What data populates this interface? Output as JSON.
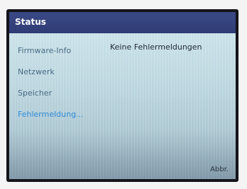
{
  "header": {
    "title": "Status"
  },
  "menu": {
    "items": [
      {
        "label": "Firmware-Info"
      },
      {
        "label": "Netzwerk"
      },
      {
        "label": "Speicher"
      },
      {
        "label": "Fehlermeldung..."
      }
    ],
    "selected_index": 3
  },
  "content": {
    "message": "Keine Fehlermeldungen"
  },
  "softkeys": {
    "cancel_label": "Abbr."
  },
  "colors": {
    "titlebar": "#2f3c75",
    "selected_item": "#2e8bd8",
    "menu_text": "#4a6a86"
  }
}
